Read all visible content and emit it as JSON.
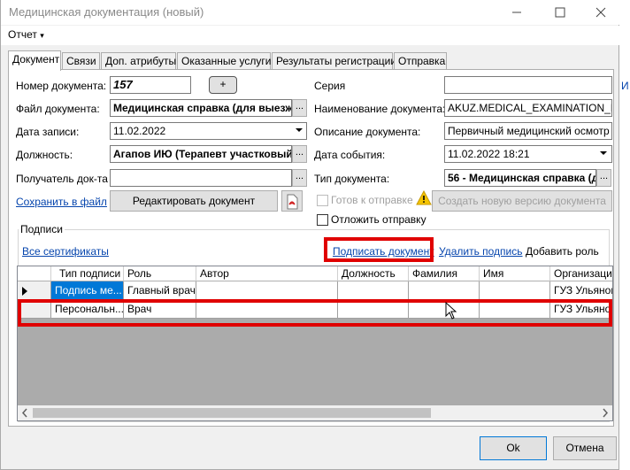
{
  "window": {
    "title": "Медицинская документация (новый)"
  },
  "menu": {
    "report": "Отчет"
  },
  "tabs": [
    "Документ",
    "Связи",
    "Доп. атрибуты",
    "Оказанные услуги",
    "Результаты регистрации",
    "Отправка"
  ],
  "left_form": {
    "doc_number_label": "Номер документа:",
    "doc_number_value": "157",
    "plus_label": "+",
    "doc_file_label": "Файл документа:",
    "doc_file_value": "Медицинская справка (для выезж",
    "record_date_label": "Дата записи:",
    "record_date_value": "11.02.2022",
    "position_label": "Должность:",
    "position_value": "Агапов ИЮ (Терапевт участковый)",
    "recipient_label": "Получатель док-та",
    "recipient_value": "",
    "save_link": "Сохранить в файл",
    "edit_button": "Редактировать документ"
  },
  "right_form": {
    "series_label": "Серия",
    "series_value": "",
    "doc_name_label": "Наименование документа:",
    "doc_name_value": "AKUZ.MEDICAL_EXAMINATION_MAI",
    "doc_desc_label": "Описание документа:",
    "doc_desc_value": "Первичный медицинский осмотр",
    "event_date_label": "Дата события:",
    "event_date_value": "11.02.2022 18:21",
    "doc_type_label": "Тип документа:",
    "doc_type_value": "56 - Медицинская справка (д",
    "ready_label": "Готов к отправке",
    "new_version_button": "Создать новую версию документа",
    "postpone_label": "Отложить отправку"
  },
  "signatures": {
    "group_label": "Подписи",
    "all_certs_link": "Все сертификаты",
    "sign_link": "Подписать документ",
    "delete_link": "Удалить подпись",
    "add_role": "Добавить роль",
    "columns": [
      "Тип подписи",
      "Роль",
      "Автор",
      "Должность",
      "Фамилия",
      "Имя",
      "Организация"
    ],
    "rows": [
      [
        "Подпись ме...",
        "Главный врач",
        "",
        "",
        "",
        "",
        "ГУЗ Ульянов"
      ],
      [
        "Персональн...",
        "Врач",
        "",
        "",
        "",
        "",
        "ГУЗ Ульянов"
      ]
    ]
  },
  "footer": {
    "ok": "Ok",
    "cancel": "Отмена"
  },
  "colors": {
    "highlight": "#e00000",
    "link": "#0645ad",
    "selected_cell": "#0078d7"
  }
}
